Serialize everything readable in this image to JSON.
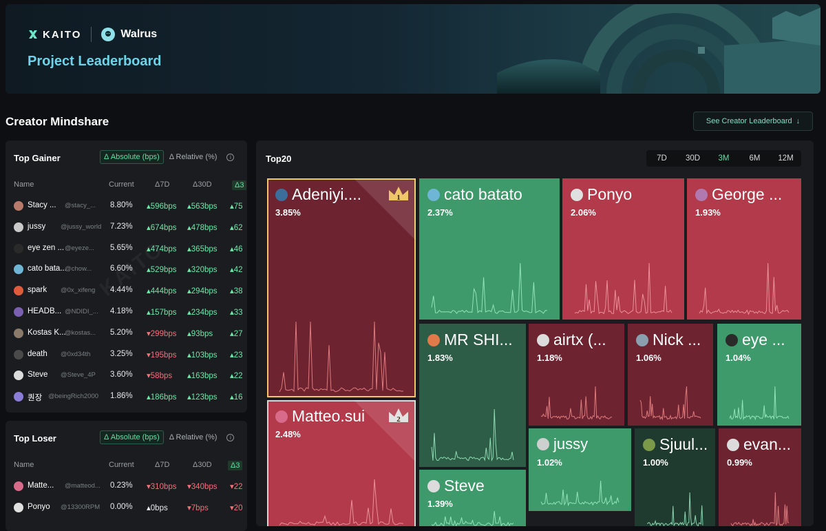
{
  "header": {
    "kaito_logo_text": "KAITO",
    "project_name": "Walrus",
    "title": "Project Leaderboard"
  },
  "section": {
    "title": "Creator Mindshare",
    "see_button": "See Creator Leaderboard",
    "see_icon": "arrow-down-icon"
  },
  "gainer": {
    "title": "Top Gainer",
    "toggle_abs": "Δ Absolute (bps)",
    "toggle_rel": "Δ Relative (%)",
    "columns": [
      "Name",
      "Current",
      "Δ7D",
      "Δ30D",
      "Δ3"
    ],
    "rows": [
      {
        "name": "Stacy ...",
        "handle": "@stacy_...",
        "current": "8.80%",
        "d7": "▴596bps",
        "d30": "▴563bps",
        "d3m": "▴75",
        "d7dir": "up",
        "d30dir": "up",
        "avatar": "#b87a6a"
      },
      {
        "name": "jussy",
        "handle": "@jussy_world",
        "current": "7.23%",
        "d7": "▴674bps",
        "d30": "▴478bps",
        "d3m": "▴62",
        "d7dir": "up",
        "d30dir": "up",
        "avatar": "#c9c9c9"
      },
      {
        "name": "eye zen ...",
        "handle": "@eyeze...",
        "current": "5.65%",
        "d7": "▴474bps",
        "d30": "▴365bps",
        "d3m": "▴46",
        "d7dir": "up",
        "d30dir": "up",
        "avatar": "#2a2a2a"
      },
      {
        "name": "cato bata...",
        "handle": "@chow...",
        "current": "6.60%",
        "d7": "▴529bps",
        "d30": "▴320bps",
        "d3m": "▴42",
        "d7dir": "up",
        "d30dir": "up",
        "avatar": "#6fb5d6"
      },
      {
        "name": "spark",
        "handle": "@0x_xifeng",
        "current": "4.44%",
        "d7": "▴444bps",
        "d30": "▴294bps",
        "d3m": "▴38",
        "d7dir": "up",
        "d30dir": "up",
        "avatar": "#e05a3c"
      },
      {
        "name": "HEADB...",
        "handle": "@NDIDI_...",
        "current": "4.18%",
        "d7": "▴157bps",
        "d30": "▴234bps",
        "d3m": "▴33",
        "d7dir": "up",
        "d30dir": "up",
        "avatar": "#7b5fb0"
      },
      {
        "name": "Kostas K...",
        "handle": "@kostas...",
        "current": "5.20%",
        "d7": "▾299bps",
        "d30": "▴93bps",
        "d3m": "▴27",
        "d7dir": "down",
        "d30dir": "up",
        "avatar": "#8a7a6a"
      },
      {
        "name": "death",
        "handle": "@0xd34th",
        "current": "3.25%",
        "d7": "▾195bps",
        "d30": "▴103bps",
        "d3m": "▴23",
        "d7dir": "down",
        "d30dir": "up",
        "avatar": "#4a4a4a"
      },
      {
        "name": "Steve",
        "handle": "@Steve_4P",
        "current": "3.60%",
        "d7": "▾58bps",
        "d30": "▴163bps",
        "d3m": "▴22",
        "d7dir": "down",
        "d30dir": "up",
        "avatar": "#dcdcdc"
      },
      {
        "name": "퀀장",
        "handle": "@beingRich2000",
        "current": "1.86%",
        "d7": "▴186bps",
        "d30": "▴123bps",
        "d3m": "▴16",
        "d7dir": "up",
        "d30dir": "up",
        "avatar": "#8b7cd8"
      }
    ]
  },
  "loser": {
    "title": "Top Loser",
    "toggle_abs": "Δ Absolute (bps)",
    "toggle_rel": "Δ Relative (%)",
    "columns": [
      "Name",
      "Current",
      "Δ7D",
      "Δ30D",
      "Δ3"
    ],
    "rows": [
      {
        "name": "Matte...",
        "handle": "@matteod...",
        "current": "0.23%",
        "d7": "▾310bps",
        "d30": "▾340bps",
        "d3m": "▾22",
        "d7dir": "down",
        "d30dir": "down",
        "avatar": "#d86a8a"
      },
      {
        "name": "Ponyo",
        "handle": "@13300RPM",
        "current": "0.00%",
        "d7": "▴0bps",
        "d30": "▾7bps",
        "d3m": "▾20",
        "d7dir": "neutral",
        "d30dir": "down",
        "avatar": "#e0e0e0"
      }
    ]
  },
  "top20": {
    "title": "Top20",
    "timeframes": [
      "7D",
      "30D",
      "3M",
      "6M",
      "12M"
    ],
    "active_timeframe": "3M",
    "watermark": "KAITO",
    "tiles": [
      {
        "name": "Adeniyi....",
        "pct": "3.85%",
        "rank": "1"
      },
      {
        "name": "Matteo.sui",
        "pct": "2.48%",
        "rank": "2"
      },
      {
        "name": "cato batato",
        "pct": "2.37%"
      },
      {
        "name": "Ponyo",
        "pct": "2.06%"
      },
      {
        "name": "George ...",
        "pct": "1.93%"
      },
      {
        "name": "MR SHI...",
        "pct": "1.83%"
      },
      {
        "name": "airtx (...",
        "pct": "1.18%"
      },
      {
        "name": "Nick ...",
        "pct": "1.06%"
      },
      {
        "name": "eye ...",
        "pct": "1.04%"
      },
      {
        "name": "jussy",
        "pct": "1.02%"
      },
      {
        "name": "Sjuul...",
        "pct": "1.00%"
      },
      {
        "name": "evan...",
        "pct": "0.99%"
      },
      {
        "name": "Steve",
        "pct": "1.39%"
      }
    ]
  }
}
